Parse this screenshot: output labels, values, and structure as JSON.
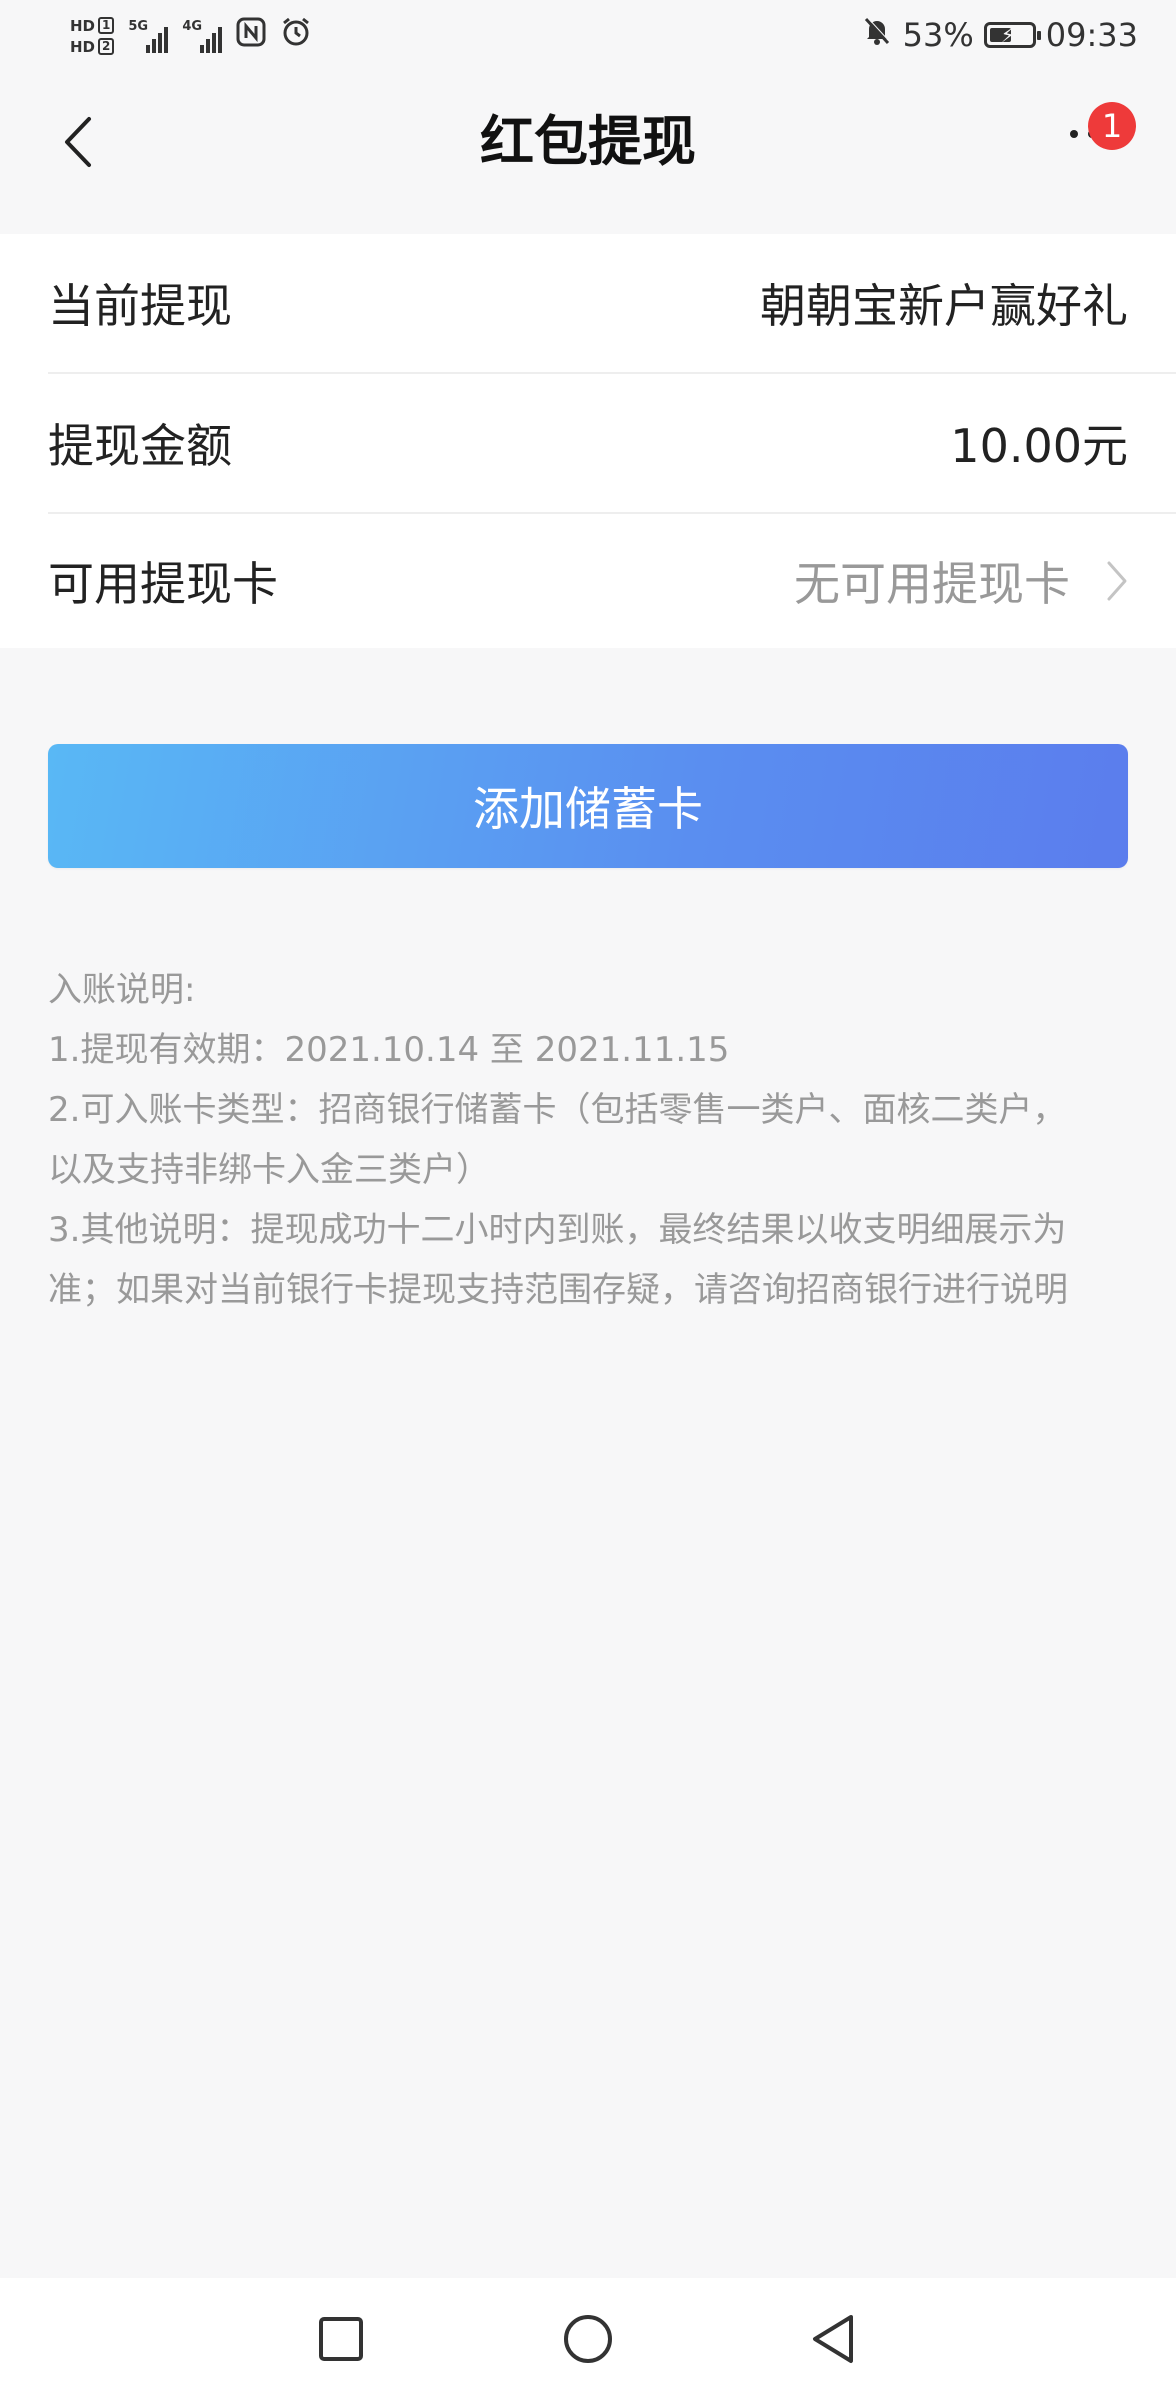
{
  "status_bar": {
    "hd1": "HD",
    "hd1_slot": "1",
    "hd2": "HD",
    "hd2_slot": "2",
    "sim1_gen": "5G",
    "sim2_gen": "4G",
    "battery_percent": "53%",
    "battery_level": 0.53,
    "time": "09:33",
    "icons": [
      "nfc-icon",
      "alarm-icon",
      "bell-muted-icon",
      "battery-charging-icon"
    ]
  },
  "nav": {
    "title": "红包提现",
    "badge_count": "1",
    "icons": [
      "back-chevron-icon",
      "more-dots-icon"
    ]
  },
  "info": {
    "rows": [
      {
        "label": "当前提现",
        "value": "朝朝宝新户赢好礼"
      },
      {
        "label": "提现金额",
        "value": "10.00元"
      },
      {
        "label": "可用提现卡",
        "value": "无可用提现卡"
      }
    ]
  },
  "button": {
    "label": "添加储蓄卡"
  },
  "notes": {
    "lines": [
      "入账说明:",
      "1.提现有效期：2021.10.14 至 2021.11.15",
      "2.可入账卡类型：招商银行储蓄卡（包括零售一类户、面核二类户，",
      "以及支持非绑卡入金三类户）",
      "3.其他说明：提现成功十二小时内到账，最终结果以收支明细展示为",
      "准；如果对当前银行卡提现支持范围存疑，请咨询招商银行进行说明"
    ]
  },
  "colors": {
    "accent_start": "#59b8f5",
    "accent_end": "#5b7ded",
    "badge": "#ee3a3a",
    "muted_text": "#999999"
  }
}
